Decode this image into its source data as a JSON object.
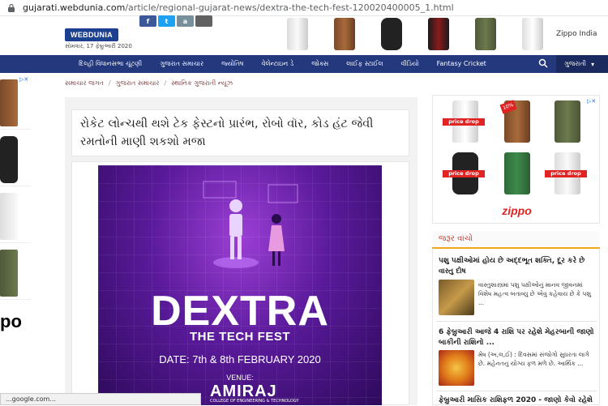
{
  "browser": {
    "host": "gujarati.webdunia.com",
    "path": "/article/regional-gujarat-news/dextra-the-tech-fest-120020400005_1.html",
    "status": "...google.com..."
  },
  "header": {
    "logo": "WEBDUNIA",
    "date": "સોમવાર, 17 ફેબ્રુઆરી 2020",
    "zippo_link": "Zippo India",
    "social": [
      "f",
      "t",
      "a",
      ""
    ]
  },
  "nav": {
    "items": [
      "દિલ્હી વિધાનસભા ચૂંટણી",
      "ગુજરાત સમાચાર",
      "જ્યોતિષ",
      "વેલેન્ટાઇન ડે",
      "જોક્સ",
      "લાઈફ સ્ટાઈલ",
      "વીડિયો",
      "Fantasy Cricket"
    ],
    "language": "ગુજરાતી"
  },
  "breadcrumb": [
    "સમાચાર જગત",
    "ગુજરાત સમાચાર",
    "સ્થાનિક ગુજરાતી ન્યૂઝ"
  ],
  "article": {
    "headline": "રોકેટ લોન્ચથી થશે ટેક ફેસ્ટનો પ્રારંભ, રોબો વૉર, કોડ હંટ જેવી રમતોની માણી શકશો મજા",
    "poster": {
      "title": "DEXTRA",
      "subtitle": "THE TECH FEST",
      "date": "DATE: 7th & 8th FEBRUARY 2020",
      "venue": "VENUE:",
      "college": "AMIRAJ",
      "college_sub": "COLLEGE OF ENGINEERING & TECHNOLOGY"
    }
  },
  "ads": {
    "price_drop": "price drop",
    "discount": "10%",
    "brand": "zippo",
    "left_brand": "po"
  },
  "must_read": {
    "heading": "જરૂર વાંચો",
    "stories": [
      {
        "title": "પશુ પક્ષીઓમાં હોય છે અદ્દભૂત શક્તિ, દૂર કરે છે વાસ્તુ દોષ",
        "snippet": "વાસ્તુશાસ્ત્રમાં પશુ પક્ષીઓનું માનવ જીવનમાં વિશેષ મહત્વ બતાવ્યુ છે એવુ કહેવાય છે કે પશુ ..."
      },
      {
        "title": "6 ફેબ્રુઆરી આજે 4 રાશિ પર રહેશે મેહરબાની જાણો બાકીની રાશિનો ...",
        "snippet": "મેષ (અ,લ,ઈ) : દિવસમાં સંજોગો સુધરતા લાગે છે. મહેનતનું યોગ્ય ફળ મળે છે. આર્થિક ..."
      },
      {
        "title": "ફેબ્રુઆરી માસિક રાશિફળ 2020 - જાણો કેવો રહેશે"
      }
    ]
  },
  "colors": {
    "nav": "#24397d",
    "accent": "#f0a818",
    "poster": "#5a1a9a"
  }
}
